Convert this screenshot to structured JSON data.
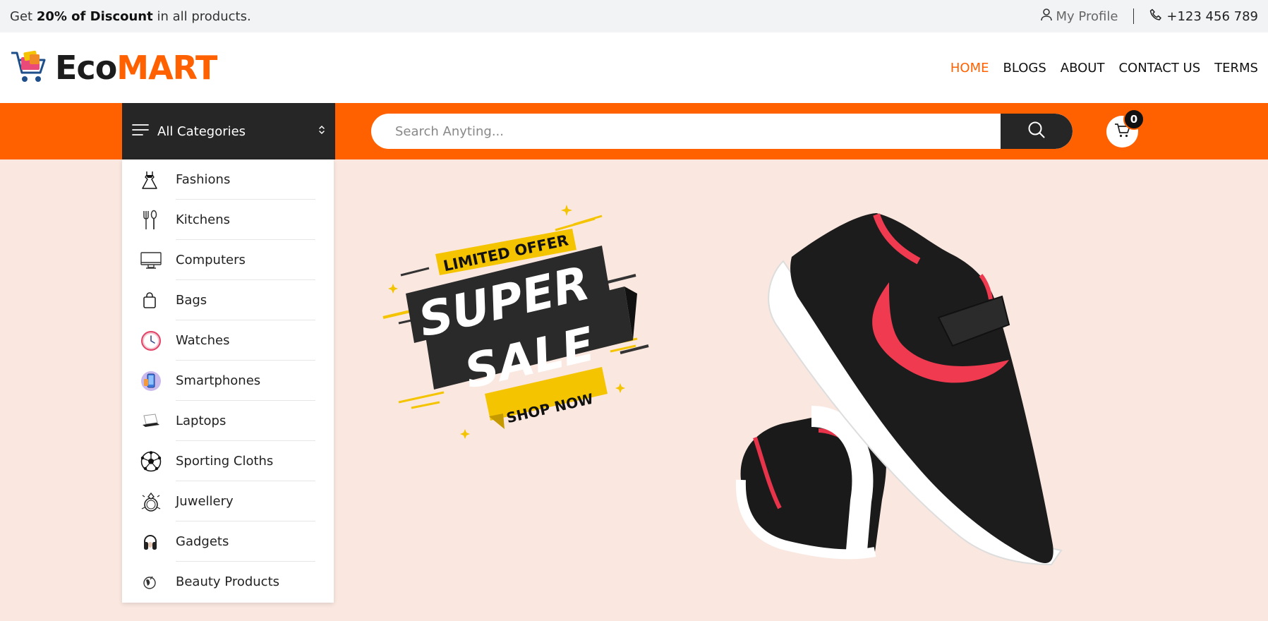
{
  "topbar": {
    "promo_prefix": "Get ",
    "promo_bold": "20% of Discount",
    "promo_suffix": " in all products.",
    "profile_label": "My Profile",
    "phone": "+123 456 789"
  },
  "brand": {
    "part1": "Eco",
    "part2": "MART",
    "accent_color": "#ff6100"
  },
  "nav": [
    {
      "label": "HOME",
      "active": true
    },
    {
      "label": "BLOGS",
      "active": false
    },
    {
      "label": "ABOUT",
      "active": false
    },
    {
      "label": "CONTACT US",
      "active": false
    },
    {
      "label": "TERMS",
      "active": false
    }
  ],
  "categories_button": {
    "label": "All Categories"
  },
  "search": {
    "placeholder": "Search Anyting..."
  },
  "cart": {
    "count": "0"
  },
  "categories": [
    {
      "label": "Fashions",
      "icon": "dress-icon"
    },
    {
      "label": "Kitchens",
      "icon": "fork-spoon-icon"
    },
    {
      "label": "Computers",
      "icon": "monitor-icon"
    },
    {
      "label": "Bags",
      "icon": "bag-icon"
    },
    {
      "label": "Watches",
      "icon": "clock-icon"
    },
    {
      "label": "Smartphones",
      "icon": "smartphone-icon"
    },
    {
      "label": "Laptops",
      "icon": "laptop-icon"
    },
    {
      "label": "Sporting Cloths",
      "icon": "football-icon"
    },
    {
      "label": "Juwellery",
      "icon": "ring-icon"
    },
    {
      "label": "Gadgets",
      "icon": "headphones-icon"
    },
    {
      "label": "Beauty Products",
      "icon": "beauty-icon"
    }
  ],
  "hero": {
    "badge_top": "LIMITED OFFER",
    "headline1": "SUPER",
    "headline2": "SALE",
    "cta": "SHOP NOW"
  }
}
